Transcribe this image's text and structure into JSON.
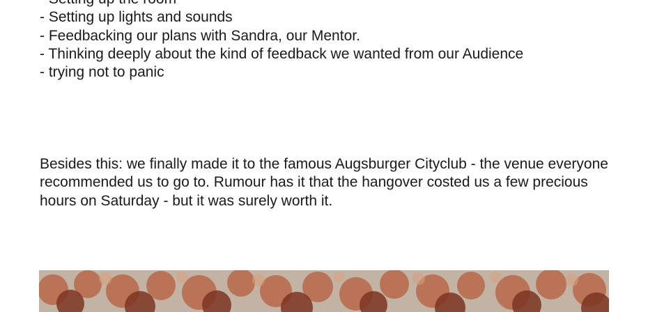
{
  "checklist": {
    "items": [
      "- Setting up the room",
      "- Setting up lights and sounds",
      "- Feedbacking our plans with Sandra, our Mentor.",
      "- Thinking deeply about the kind of feedback we wanted from our Audience",
      "- trying not to panic"
    ]
  },
  "paragraph": {
    "text": "Besides this: we finally made it to the famous Augsburger Cityclub  - the venue everyone recommended us to go to. Rumour has it that the hangover costed us a few precious hours on Saturday - but it was surely worth it."
  },
  "photo": {
    "subject": "autumn-trees",
    "colors": {
      "sky": "#c7b9ab",
      "foliage_light": "#c9825f",
      "foliage_dark": "#7a3320"
    }
  }
}
